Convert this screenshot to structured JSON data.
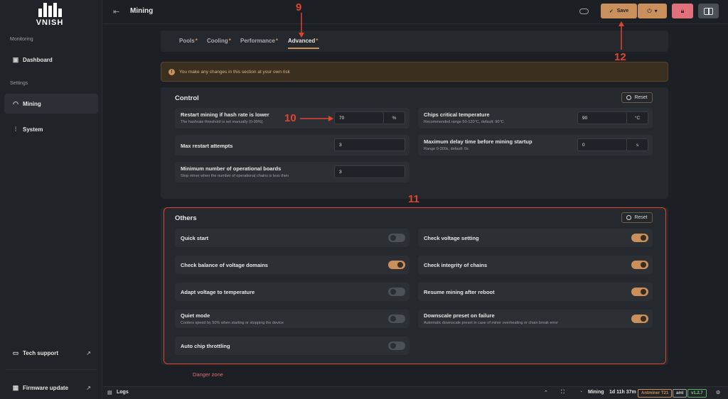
{
  "sidebar": {
    "brand": "VNISH",
    "section_monitoring": "Monitoring",
    "dashboard": "Dashboard",
    "section_settings": "Settings",
    "mining": "Mining",
    "system": "System",
    "tech_support": "Tech support",
    "firmware_update": "Firmware update"
  },
  "header": {
    "title": "Mining",
    "save_label": "Save"
  },
  "tabs": [
    {
      "label": "Pools",
      "star": "*"
    },
    {
      "label": "Cooling",
      "star": "*"
    },
    {
      "label": "Performance",
      "star": "*"
    },
    {
      "label": "Advanced",
      "star": "*"
    }
  ],
  "warning": "You make any changes in this section at your own risk",
  "control": {
    "title": "Control",
    "reset": "Reset",
    "restart_hashrate": {
      "label": "Restart mining if hash rate is lower",
      "sub": "The hashrate threshold is set manually (0-99%)",
      "value": "70",
      "unit": "%"
    },
    "chips_temp": {
      "label": "Chips critical temperature",
      "sub": "Recommended range 50-120°C, default: 90°C",
      "value": "90",
      "unit": "°C"
    },
    "max_restart": {
      "label": "Max restart attempts",
      "value": "3"
    },
    "max_delay": {
      "label": "Maximum delay time before mining startup",
      "sub": "Range 0-300s, default: 0s",
      "value": "0",
      "unit": "s"
    },
    "min_boards": {
      "label": "Minimum number of operational boards",
      "sub": "Stop miner when the number of operational chains is less then",
      "value": "3"
    }
  },
  "others": {
    "title": "Others",
    "reset": "Reset",
    "items": [
      {
        "label": "Quick start",
        "sub": "",
        "on": false
      },
      {
        "label": "Check voltage setting",
        "sub": "",
        "on": true
      },
      {
        "label": "Check balance of voltage domains",
        "sub": "",
        "on": true
      },
      {
        "label": "Check integrity of chains",
        "sub": "",
        "on": true
      },
      {
        "label": "Adapt voltage to temperature",
        "sub": "",
        "on": false
      },
      {
        "label": "Resume mining after reboot",
        "sub": "",
        "on": true
      },
      {
        "label": "Quiet mode",
        "sub": "Coolers speed by 50% when starting or stopping the device",
        "on": false
      },
      {
        "label": "Downscale preset on failure",
        "sub": "Automatic downscale preset in case of miner overheating or chain break error",
        "on": true
      },
      {
        "label": "Auto chip throttling",
        "sub": "",
        "on": false
      }
    ]
  },
  "danger_zone": "Danger zone",
  "annotations": {
    "a9": "9",
    "a10": "10",
    "a11": "11",
    "a12": "12"
  },
  "bottombar": {
    "logs": "Logs",
    "status": "Mining",
    "uptime": "1d 11h 37m",
    "model": "Antminer T21",
    "platform": "aml",
    "version": "v1.2.7"
  },
  "colors": {
    "accent": "#c9905c",
    "annotation": "#e0432f",
    "danger": "#e0707a"
  }
}
